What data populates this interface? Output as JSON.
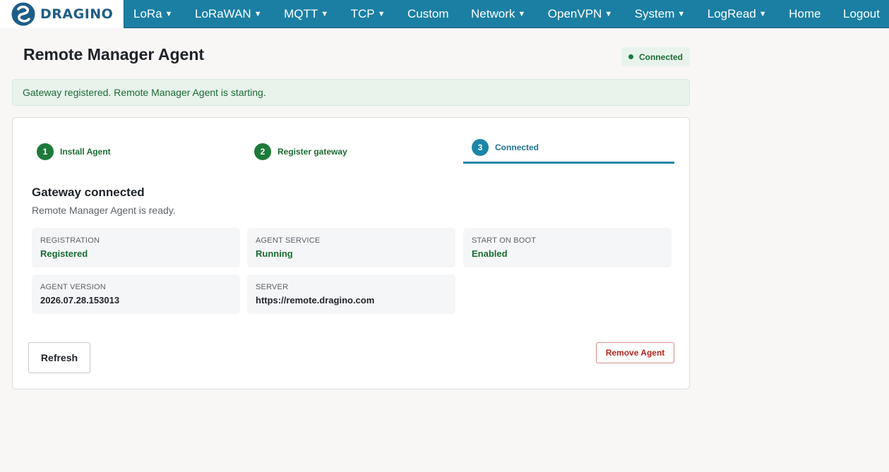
{
  "brand": {
    "name": "DRAGINO"
  },
  "nav": {
    "items": [
      {
        "label": "LoRa",
        "dropdown": true
      },
      {
        "label": "LoRaWAN",
        "dropdown": true
      },
      {
        "label": "MQTT",
        "dropdown": true
      },
      {
        "label": "TCP",
        "dropdown": true
      },
      {
        "label": "Custom",
        "dropdown": false
      },
      {
        "label": "Network",
        "dropdown": true
      },
      {
        "label": "OpenVPN",
        "dropdown": true
      },
      {
        "label": "System",
        "dropdown": true
      },
      {
        "label": "LogRead",
        "dropdown": true
      },
      {
        "label": "Home",
        "dropdown": false
      },
      {
        "label": "Logout",
        "dropdown": false
      }
    ],
    "caret_glyph": "▼"
  },
  "page": {
    "title": "Remote Manager Agent",
    "status_badge": "Connected",
    "alert": "Gateway registered. Remote Manager Agent is starting."
  },
  "steps": [
    {
      "number": "1",
      "label": "Install Agent",
      "state": "done"
    },
    {
      "number": "2",
      "label": "Register gateway",
      "state": "done"
    },
    {
      "number": "3",
      "label": "Connected",
      "state": "active"
    }
  ],
  "status": {
    "title": "Gateway connected",
    "subtitle": "Remote Manager Agent is ready.",
    "fields": [
      {
        "label": "REGISTRATION",
        "value": "Registered"
      },
      {
        "label": "AGENT SERVICE",
        "value": "Running"
      },
      {
        "label": "START ON BOOT",
        "value": "Enabled"
      },
      {
        "label": "AGENT VERSION",
        "value": "2026.07.28.153013"
      },
      {
        "label": "SERVER",
        "value": "https://remote.dragino.com"
      }
    ]
  },
  "actions": {
    "refresh": "Refresh",
    "remove": "Remove Agent"
  },
  "colors": {
    "nav_bg": "#1b7fa3",
    "success": "#1b6b33",
    "active_step": "#1c86a8",
    "danger": "#b3261e"
  }
}
